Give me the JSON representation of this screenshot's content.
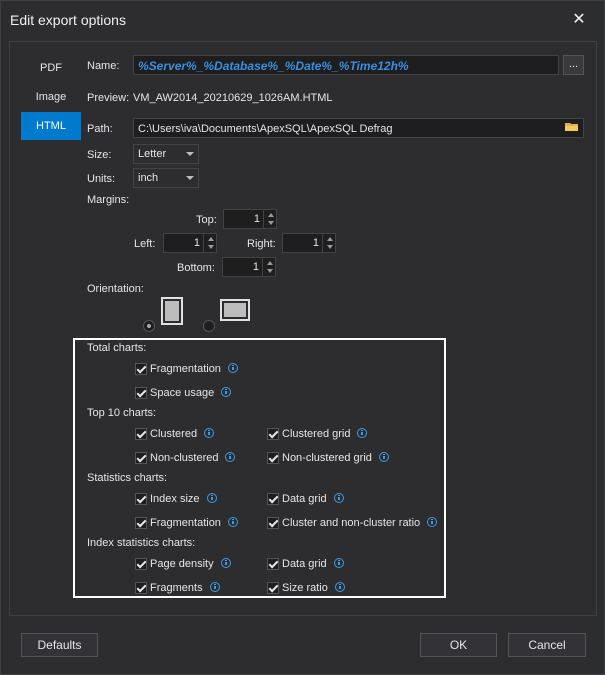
{
  "window": {
    "title": "Edit export options",
    "close_glyph": "✕"
  },
  "tabs": [
    {
      "label": "PDF",
      "active": false
    },
    {
      "label": "Image",
      "active": false
    },
    {
      "label": "HTML",
      "active": true
    }
  ],
  "form": {
    "name_label": "Name:",
    "name_value": "%Server%_%Database%_%Date%_%Time12h%",
    "browse_label": "...",
    "preview_label": "Preview:",
    "preview_value": "VM_AW2014_20210629_1026AM.HTML",
    "path_label": "Path:",
    "path_value": "C:\\Users\\iva\\Documents\\ApexSQL\\ApexSQL Defrag",
    "size_label": "Size:",
    "size_value": "Letter",
    "units_label": "Units:",
    "units_value": "inch",
    "margins_label": "Margins:",
    "top_label": "Top:",
    "top_value": "1",
    "left_label": "Left:",
    "left_value": "1",
    "right_label": "Right:",
    "right_value": "1",
    "bottom_label": "Bottom:",
    "bottom_value": "1",
    "orientation_label": "Orientation:",
    "orientation_selected": "portrait"
  },
  "charts": {
    "total_label": "Total charts:",
    "total_items": [
      "Fragmentation",
      "Space usage"
    ],
    "top10_label": "Top 10 charts:",
    "top10_items": [
      "Clustered",
      "Clustered grid",
      "Non-clustered",
      "Non-clustered grid"
    ],
    "stats_label": "Statistics charts:",
    "stats_items": [
      "Index size",
      "Data grid",
      "Fragmentation",
      "Cluster and non-cluster ratio"
    ],
    "index_label": "Index statistics charts:",
    "index_items": [
      "Page density",
      "Data grid",
      "Fragments",
      "Size ratio"
    ]
  },
  "footer": {
    "defaults_label": "Defaults",
    "ok_label": "OK",
    "cancel_label": "Cancel"
  },
  "colors": {
    "accent": "#007acc",
    "info": "#3c9ce8",
    "name_text": "#3c8fe0"
  }
}
